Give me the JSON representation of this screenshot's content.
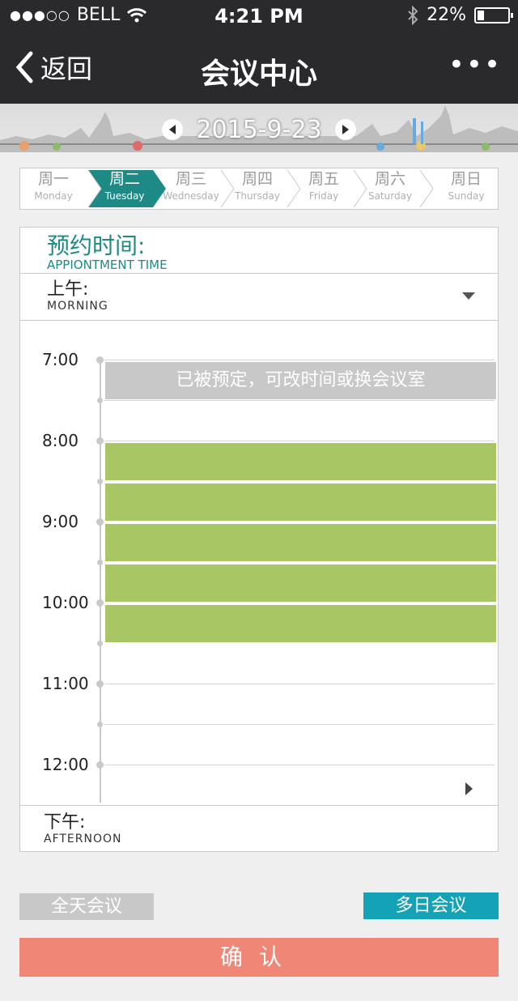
{
  "status_bar": {
    "signal_dots": "●●●○○",
    "carrier": "BELL",
    "time": "4:21 PM",
    "battery_text": "22%",
    "battery_level": 0.22
  },
  "nav": {
    "back_label": "返回",
    "title": "会议中心",
    "more_label": "•••"
  },
  "date_bar": {
    "date": "2015-9-23"
  },
  "week": {
    "days": [
      {
        "cn": "周一",
        "en": "Monday"
      },
      {
        "cn": "周二",
        "en": "Tuesday"
      },
      {
        "cn": "周三",
        "en": "Wednesday"
      },
      {
        "cn": "周四",
        "en": "Thursday"
      },
      {
        "cn": "周五",
        "en": "Friday"
      },
      {
        "cn": "周六",
        "en": "Saturday"
      },
      {
        "cn": "周日",
        "en": "Sunday"
      }
    ],
    "selected_index": 1
  },
  "appointment": {
    "title_cn": "预约时间:",
    "title_en": "APPIONTMENT TIME",
    "morning_cn": "上午:",
    "morning_en": "MORNING",
    "afternoon_cn": "下午:",
    "afternoon_en": "AFTERNOON",
    "hours": [
      "7:00",
      "8:00",
      "9:00",
      "10:00",
      "11:00",
      "12:00"
    ],
    "booked_text": "已被预定，可改时间或换会议室"
  },
  "buttons": {
    "all_day": "全天会议",
    "multi_day": "多日会议",
    "confirm": "确认"
  },
  "colors": {
    "header_bg": "#2a2a2d",
    "accent_teal": "#1e8a86",
    "slot_green": "#a8c764",
    "booked_gray": "#c8c8c8",
    "multi_btn": "#14a2b6",
    "confirm_btn": "#ef8676"
  }
}
